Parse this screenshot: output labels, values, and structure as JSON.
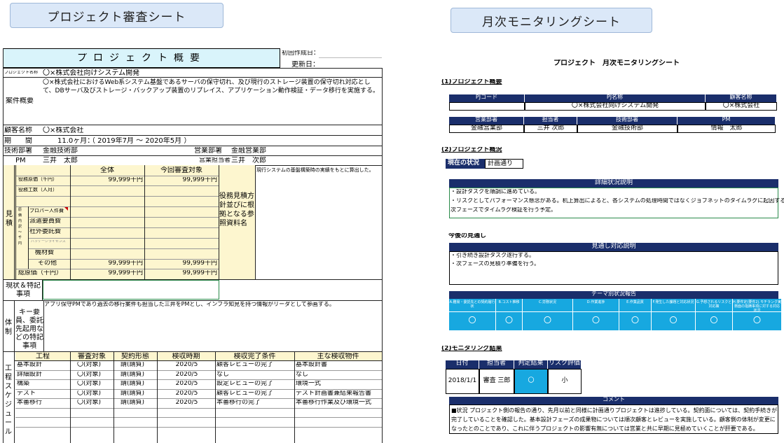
{
  "left": {
    "pill": "プロジェクト審査シート",
    "title": "プロジェクト概要",
    "created_label": "初回作成日：",
    "updated_label": "更新日：",
    "project_name_label": "プロジェクト名称",
    "project_name": "〇×株式会社向けシステム開発",
    "summary_label": "案件概要",
    "summary": "〇×株式会社におけるWeb系システム基盤であるサーバの保守切れ、及び現行のストレージ装置の保守切れ対応として、DBサーバ及びストレージ・バックアップ装置のリプレイス、アプリケーション動作検証・データ移行を実施する。",
    "customer_label": "顧客名称",
    "customer": "〇×株式会社",
    "period_label": "期　　間",
    "period_months": "11.0ヶ月：",
    "period_range": "（ 2019年7月 ～ 2020年5月 ）",
    "tech_dept_label": "技術部署",
    "tech_dept": "金融技術部",
    "sales_dept_label": "営業部署",
    "sales_dept": "金融営業部",
    "pm_label": "PM",
    "pm": "三井　太郎",
    "sales_rep_label": "営業担当者",
    "sales_rep": "三井　次郎",
    "estimate": {
      "side_label": "見積",
      "col_all": "全体",
      "col_review": "今回審査対象",
      "row_price": "役務原価（千円）",
      "row_workload": "役務工数（人月）",
      "row_proper": "プロパー人件費",
      "row_travel": "派遣要員費",
      "row_outsource": "社外委託費",
      "row_package": "パッケージライセンス",
      "row_equipment": "機材費",
      "row_other": "その他",
      "row_total": "総原価（千円）",
      "sub_label": "原価内訳～千円",
      "price_all": "99,999千円",
      "price_review": "99,999千円",
      "other_all": "99,999千円",
      "other_review": "99,999千円",
      "total_all": "99,999千円",
      "total_review": "99,999千円",
      "basis_label": "役務見積方針並びに根拠となる参照資料名",
      "basis_text": "現行システムの基盤構築時の実績をもとに算出した。"
    },
    "status_label": "現状＆特記事項",
    "team": {
      "side_label": "体制",
      "key_label": "キー要員、委託先起用などの特記事項",
      "note": "アプリ保守PMであり過去の移行案件も担当した三井をPMとし、インフラ知見を持つ情報がリーダとして参画する。"
    },
    "process": {
      "side_label": "工程・スケジュール",
      "headers": [
        "工程",
        "審査対象",
        "契約形態",
        "検収時期",
        "検収完了条件",
        "主な検収物件"
      ],
      "rows": [
        [
          "基本設計",
          "〇(対象)",
          "請(請負)",
          "2020/5",
          "顧客レビューの完了",
          "基本設計書"
        ],
        [
          "詳細設計",
          "〇(対象)",
          "請(請負)",
          "2020/5",
          "なし",
          "なし"
        ],
        [
          "構築",
          "〇(対象)",
          "請(請負)",
          "2020/5",
          "設定レビューの完了",
          "環境一式"
        ],
        [
          "テスト",
          "〇(対象)",
          "請(請負)",
          "2020/5",
          "顧客レビューの完了",
          "テスト計画書兼結果報告書"
        ],
        [
          "本番移行",
          "〇(対象)",
          "請(請負)",
          "2020/5",
          "本番移行の完了",
          "本番移行作業及び環境一式"
        ]
      ]
    }
  },
  "right": {
    "pill": "月次モニタリングシート",
    "doc_title": "プロジェクト　月次モニタリングシート",
    "sec1": "(1)プロジェクト概要",
    "t1_headers": [
      "PJコード",
      "PJ名称",
      "顧客名称"
    ],
    "t1_values": [
      "",
      "〇×株式会社向けシステム開発",
      "〇×株式会社"
    ],
    "t2_headers": [
      "営業部署",
      "担当者",
      "技術部署",
      "PM"
    ],
    "t2_values": [
      "金融営業部",
      "三井 次郎",
      "金融技術部",
      "情報　太郎"
    ],
    "sec2": "(2)プロジェクト概況",
    "status_label": "現在の状況",
    "status_value": "計画通り",
    "detail_header": "詳細状況説明",
    "detail_lines": [
      "・設計タスクを順調に進めている。",
      "・リスクとしてパフォーマンス懸念がある。机上算出によると、各システムの処理時間ではなくジョブネットのタイムラグに起因する模様。",
      "次フェーズでタイムラグ検証を行う予定。"
    ],
    "outlook_label": "今後の見通し",
    "outlook_header": "見通し対応説明",
    "outlook_lines": [
      "・引き続き設計タスク遂行する。",
      "・次フェーズの見積り準備を行う。"
    ],
    "theme_header": "テーマ別状況報告",
    "theme_cols": [
      "A.難易・委託先との契約履行状",
      "B.コスト推移",
      "C.労務状況",
      "D.作業進捗",
      "E.作業品質",
      "F.発生した課題と対応状況",
      "G.予想されるリスクと対応策",
      "H.要件定(要件2).モチランク実務面の指摘事項に対する対応状況"
    ],
    "theme_marks": [
      "〇",
      "〇",
      "〇",
      "〇",
      "〇",
      "〇",
      "〇",
      "〇"
    ],
    "sec3": "(2)モニタリング結果",
    "mon_headers": [
      "日付",
      "担当者",
      "判定結果",
      "リスク評価"
    ],
    "mon_values": [
      "2018/1/1",
      "審査 三郎",
      "〇",
      "小"
    ],
    "comment_header": "コメント",
    "comment": "■状況 プロジェクト側の報告の通り、先月以前と同様に計画通りプロジェクトは進捗している。契約面については、契約手続きが完了していることを確認した。基本設計フェーズの成果物については順次顧客とレビューを実施している。顧客側の体制が変更になったとのことであり、これに伴うプロジェクトの影響有無については営業と共に早期に見極めていくことが肝要である。"
  },
  "colors": {
    "navy": "#1a2e6b",
    "cyan": "#17a8e0",
    "title_fill": "#d9f4fb",
    "estimate_fill": "#fdf6cf",
    "pill": "#dbe8f8"
  }
}
